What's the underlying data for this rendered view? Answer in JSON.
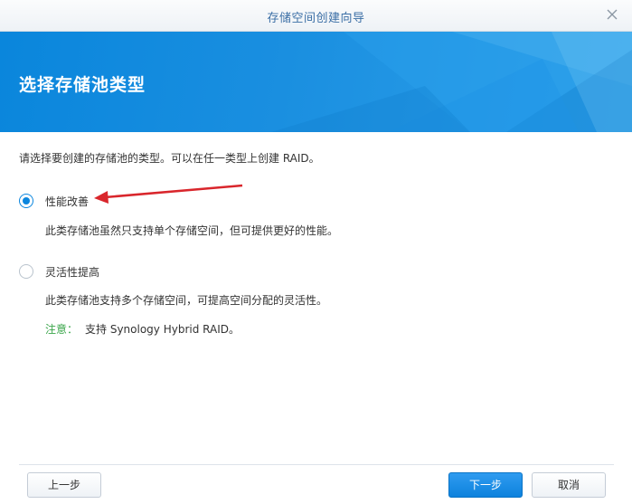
{
  "window": {
    "title": "存储空间创建向导"
  },
  "banner": {
    "title": "选择存储池类型"
  },
  "content": {
    "intro": "请选择要创建的存储池的类型。可以在任一类型上创建 RAID。",
    "options": [
      {
        "label": "性能改善",
        "description": "此类存储池虽然只支持单个存储空间，但可提供更好的性能。",
        "selected": true
      },
      {
        "label": "灵活性提高",
        "description": "此类存储池支持多个存储空间，可提高空间分配的灵活性。",
        "selected": false
      }
    ],
    "note": {
      "key": "注意：",
      "text": "支持 Synology Hybrid RAID。"
    }
  },
  "footer": {
    "prev_label": "上一步",
    "next_label": "下一步",
    "cancel_label": "取消"
  },
  "colors": {
    "accent": "#0b86de",
    "banner": "#1a8fe0",
    "note": "#3aa54a",
    "arrow": "#d9262c"
  },
  "icons": {
    "close": "close-icon",
    "annotation": "red-arrow-annotation"
  }
}
